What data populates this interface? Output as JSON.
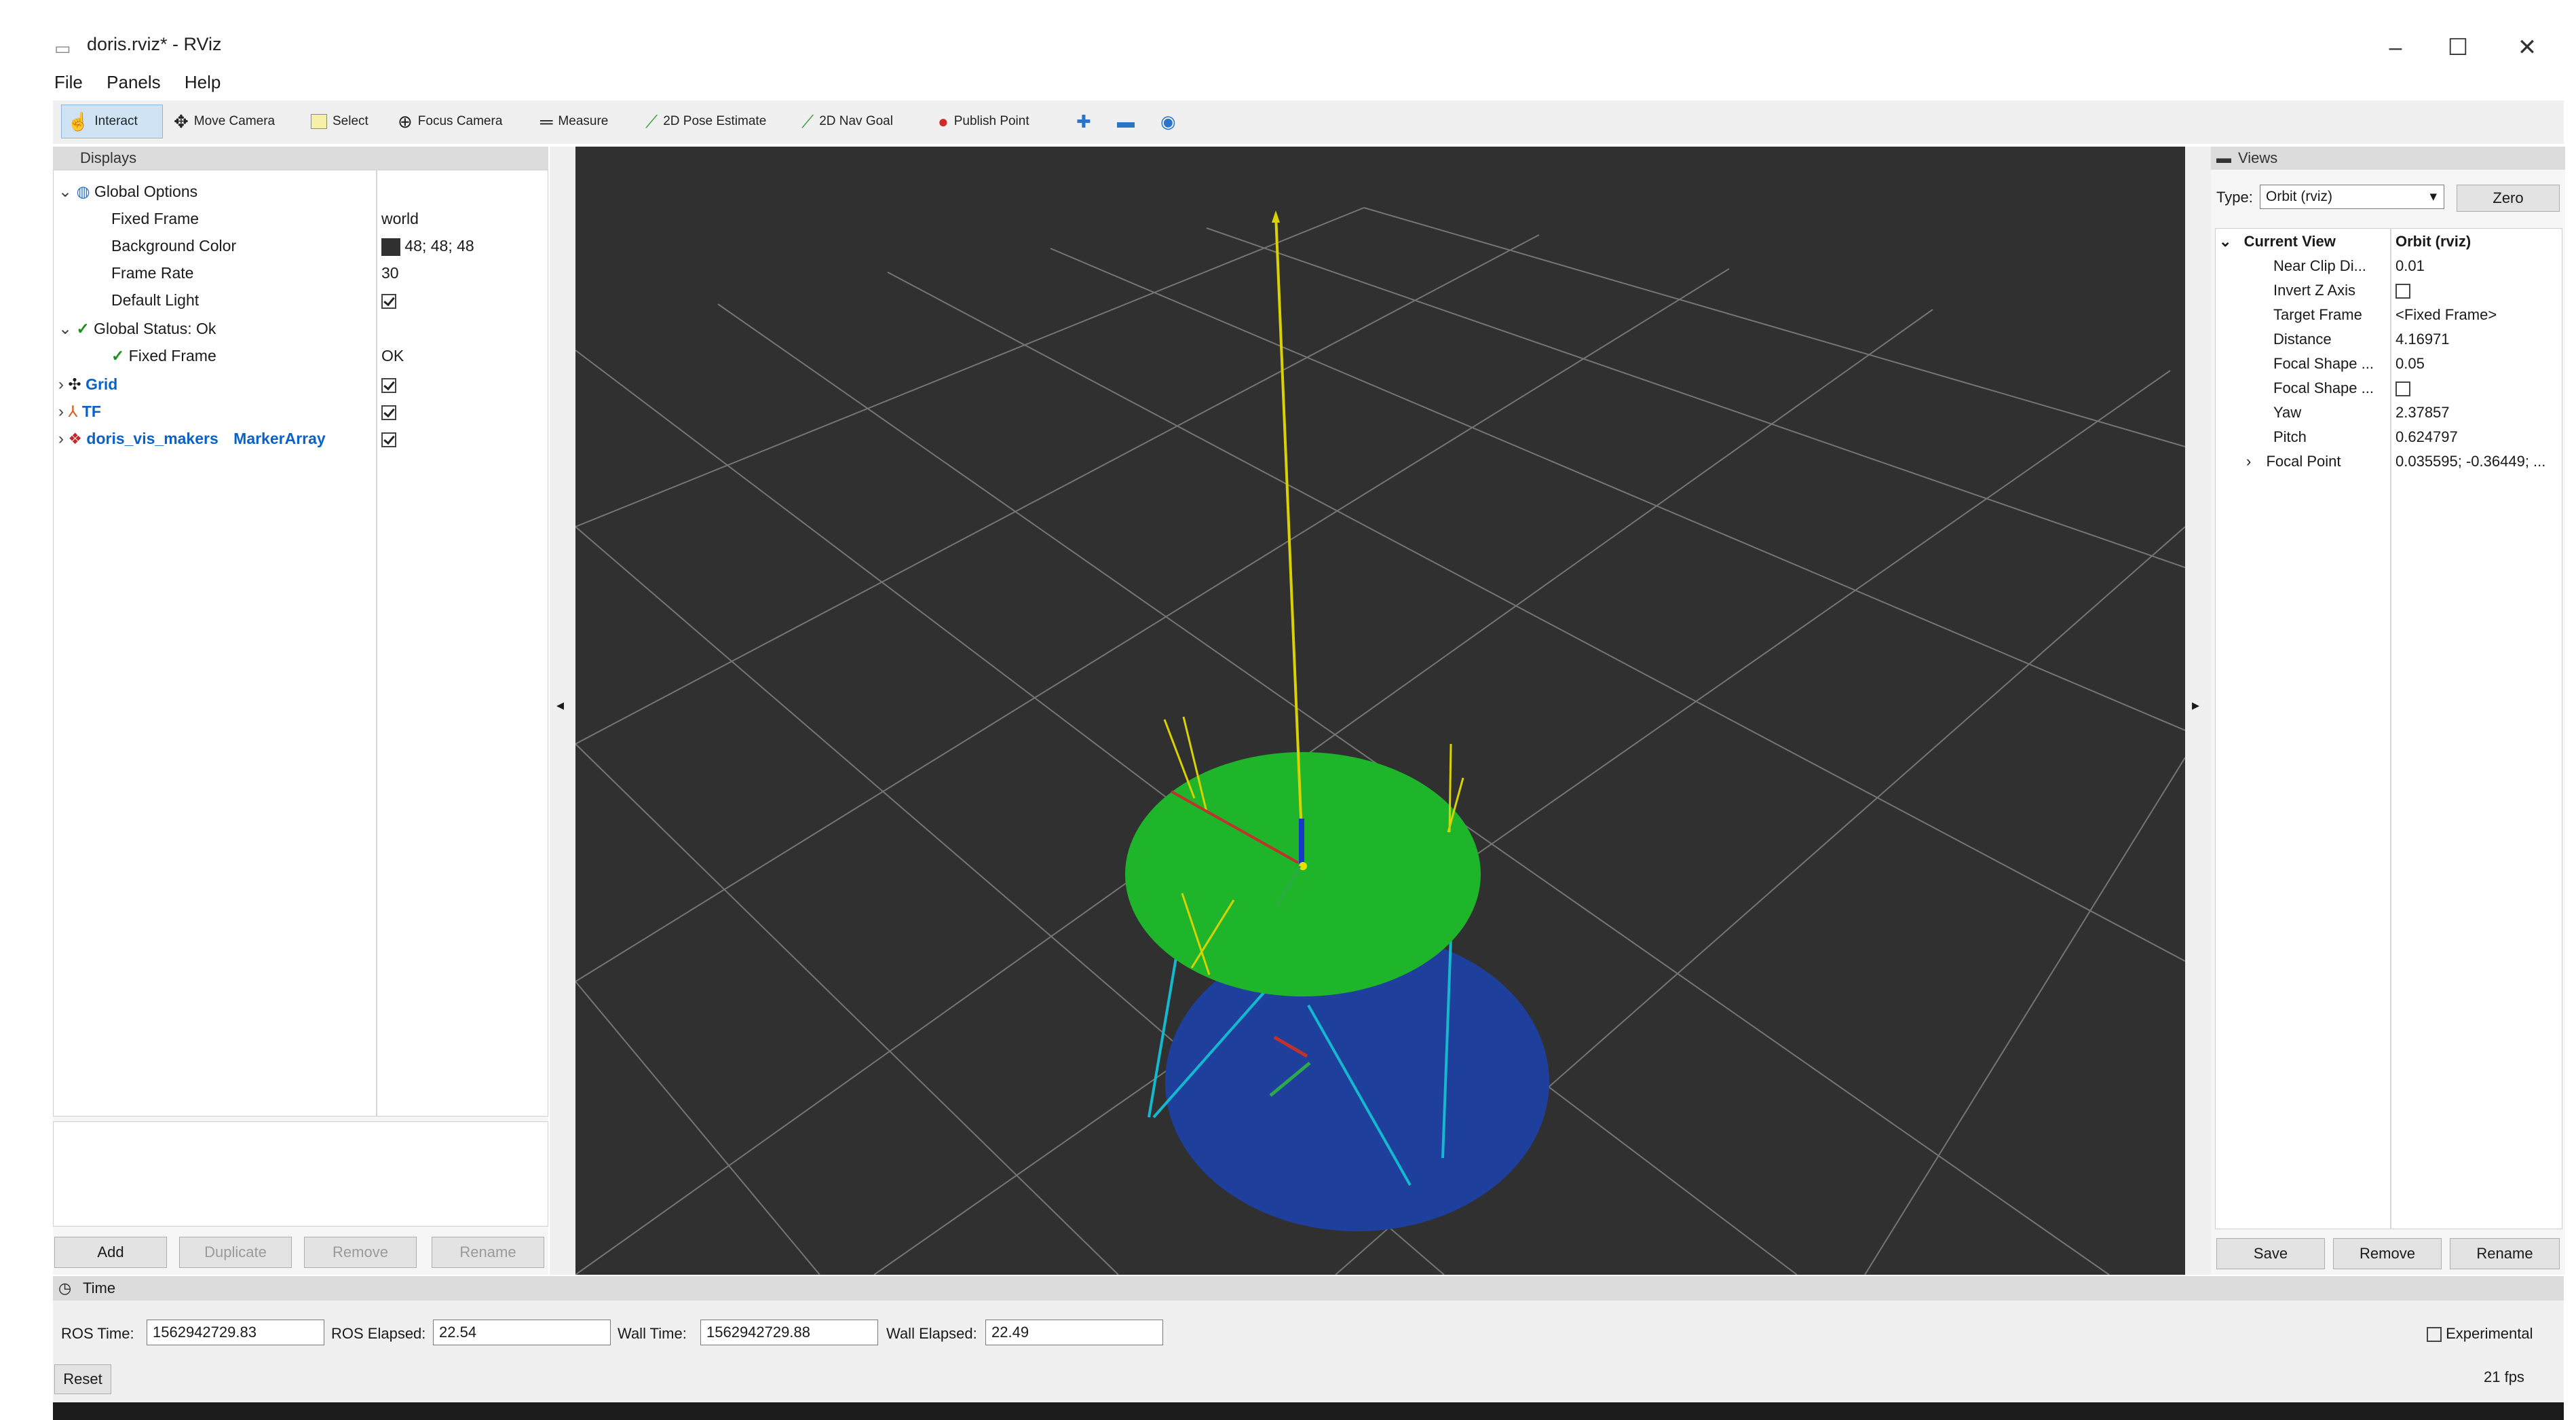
{
  "window": {
    "title": "doris.rviz* - RViz",
    "minimize": "–",
    "maximize": "☐",
    "close": "✕"
  },
  "menu": [
    "File",
    "Panels",
    "Help"
  ],
  "toolbar": [
    {
      "label": "Interact",
      "icon": "hand-icon"
    },
    {
      "label": "Move Camera",
      "icon": "move-camera-icon"
    },
    {
      "label": "Select",
      "icon": "select-icon"
    },
    {
      "label": "Focus Camera",
      "icon": "focus-icon"
    },
    {
      "label": "Measure",
      "icon": "ruler-icon"
    },
    {
      "label": "2D Pose Estimate",
      "icon": "green-arrow-icon"
    },
    {
      "label": "2D Nav Goal",
      "icon": "green-arrow-icon"
    },
    {
      "label": "Publish Point",
      "icon": "map-pin-icon"
    }
  ],
  "displays": {
    "title": "Displays",
    "global_options": "Global Options",
    "props": [
      {
        "name": "Fixed Frame",
        "value": "world"
      },
      {
        "name": "Background Color",
        "value": "48; 48; 48"
      },
      {
        "name": "Frame Rate",
        "value": "30"
      },
      {
        "name": "Default Light",
        "value": ""
      }
    ],
    "global_status": "Global Status: Ok",
    "status_fixed_frame": "Fixed Frame",
    "status_value": "OK",
    "items": [
      {
        "name": "Grid",
        "type": ""
      },
      {
        "name": "TF",
        "type": ""
      },
      {
        "name": "doris_vis_makers",
        "type": "MarkerArray"
      }
    ],
    "buttons": {
      "add": "Add",
      "duplicate": "Duplicate",
      "remove": "Remove",
      "rename": "Rename"
    }
  },
  "views": {
    "title": "Views",
    "type_label": "Type:",
    "type_value": "Orbit (rviz)",
    "zero": "Zero",
    "current_view": "Current View",
    "current_view_value": "Orbit (rviz)",
    "props": [
      {
        "name": "Near Clip Di...",
        "value": "0.01"
      },
      {
        "name": "Invert Z Axis",
        "value": ""
      },
      {
        "name": "Target Frame",
        "value": "<Fixed Frame>"
      },
      {
        "name": "Distance",
        "value": "4.16971"
      },
      {
        "name": "Focal Shape ...",
        "value": "0.05"
      },
      {
        "name": "Focal Shape ...",
        "value": ""
      },
      {
        "name": "Yaw",
        "value": "2.37857"
      },
      {
        "name": "Pitch",
        "value": "0.624797"
      },
      {
        "name": "Focal Point",
        "value": "0.035595; -0.36449; ..."
      }
    ],
    "buttons": {
      "save": "Save",
      "remove": "Remove",
      "rename": "Rename"
    }
  },
  "time": {
    "title": "Time",
    "ros_time_label": "ROS Time:",
    "ros_time": "1562942729.83",
    "ros_elapsed_label": "ROS Elapsed:",
    "ros_elapsed": "22.54",
    "wall_time_label": "Wall Time:",
    "wall_time": "1562942729.88",
    "wall_elapsed_label": "Wall Elapsed:",
    "wall_elapsed": "22.49",
    "experimental": "Experimental",
    "reset": "Reset",
    "fps": "21 fps"
  },
  "colors": {
    "viewport_bg": "#303030",
    "grid": "#8c8c8c",
    "top_disk": "#1fb52b",
    "bottom_disk": "#1e3f9c",
    "struts": "#14b8cf",
    "yellow_axis": "#d9d200"
  }
}
